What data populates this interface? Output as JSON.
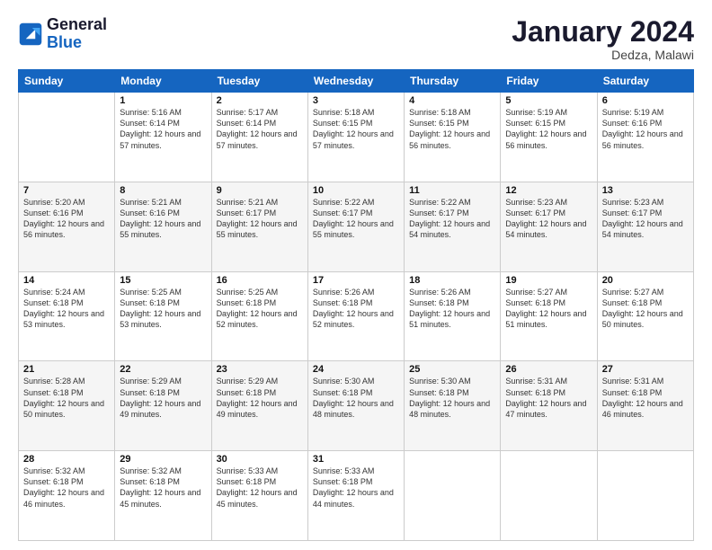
{
  "logo": {
    "line1": "General",
    "line2": "Blue"
  },
  "header": {
    "title": "January 2024",
    "subtitle": "Dedza, Malawi"
  },
  "weekdays": [
    "Sunday",
    "Monday",
    "Tuesday",
    "Wednesday",
    "Thursday",
    "Friday",
    "Saturday"
  ],
  "weeks": [
    [
      {
        "day": "",
        "sunrise": "",
        "sunset": "",
        "daylight": ""
      },
      {
        "day": "1",
        "sunrise": "Sunrise: 5:16 AM",
        "sunset": "Sunset: 6:14 PM",
        "daylight": "Daylight: 12 hours and 57 minutes."
      },
      {
        "day": "2",
        "sunrise": "Sunrise: 5:17 AM",
        "sunset": "Sunset: 6:14 PM",
        "daylight": "Daylight: 12 hours and 57 minutes."
      },
      {
        "day": "3",
        "sunrise": "Sunrise: 5:18 AM",
        "sunset": "Sunset: 6:15 PM",
        "daylight": "Daylight: 12 hours and 57 minutes."
      },
      {
        "day": "4",
        "sunrise": "Sunrise: 5:18 AM",
        "sunset": "Sunset: 6:15 PM",
        "daylight": "Daylight: 12 hours and 56 minutes."
      },
      {
        "day": "5",
        "sunrise": "Sunrise: 5:19 AM",
        "sunset": "Sunset: 6:15 PM",
        "daylight": "Daylight: 12 hours and 56 minutes."
      },
      {
        "day": "6",
        "sunrise": "Sunrise: 5:19 AM",
        "sunset": "Sunset: 6:16 PM",
        "daylight": "Daylight: 12 hours and 56 minutes."
      }
    ],
    [
      {
        "day": "7",
        "sunrise": "Sunrise: 5:20 AM",
        "sunset": "Sunset: 6:16 PM",
        "daylight": "Daylight: 12 hours and 56 minutes."
      },
      {
        "day": "8",
        "sunrise": "Sunrise: 5:21 AM",
        "sunset": "Sunset: 6:16 PM",
        "daylight": "Daylight: 12 hours and 55 minutes."
      },
      {
        "day": "9",
        "sunrise": "Sunrise: 5:21 AM",
        "sunset": "Sunset: 6:17 PM",
        "daylight": "Daylight: 12 hours and 55 minutes."
      },
      {
        "day": "10",
        "sunrise": "Sunrise: 5:22 AM",
        "sunset": "Sunset: 6:17 PM",
        "daylight": "Daylight: 12 hours and 55 minutes."
      },
      {
        "day": "11",
        "sunrise": "Sunrise: 5:22 AM",
        "sunset": "Sunset: 6:17 PM",
        "daylight": "Daylight: 12 hours and 54 minutes."
      },
      {
        "day": "12",
        "sunrise": "Sunrise: 5:23 AM",
        "sunset": "Sunset: 6:17 PM",
        "daylight": "Daylight: 12 hours and 54 minutes."
      },
      {
        "day": "13",
        "sunrise": "Sunrise: 5:23 AM",
        "sunset": "Sunset: 6:17 PM",
        "daylight": "Daylight: 12 hours and 54 minutes."
      }
    ],
    [
      {
        "day": "14",
        "sunrise": "Sunrise: 5:24 AM",
        "sunset": "Sunset: 6:18 PM",
        "daylight": "Daylight: 12 hours and 53 minutes."
      },
      {
        "day": "15",
        "sunrise": "Sunrise: 5:25 AM",
        "sunset": "Sunset: 6:18 PM",
        "daylight": "Daylight: 12 hours and 53 minutes."
      },
      {
        "day": "16",
        "sunrise": "Sunrise: 5:25 AM",
        "sunset": "Sunset: 6:18 PM",
        "daylight": "Daylight: 12 hours and 52 minutes."
      },
      {
        "day": "17",
        "sunrise": "Sunrise: 5:26 AM",
        "sunset": "Sunset: 6:18 PM",
        "daylight": "Daylight: 12 hours and 52 minutes."
      },
      {
        "day": "18",
        "sunrise": "Sunrise: 5:26 AM",
        "sunset": "Sunset: 6:18 PM",
        "daylight": "Daylight: 12 hours and 51 minutes."
      },
      {
        "day": "19",
        "sunrise": "Sunrise: 5:27 AM",
        "sunset": "Sunset: 6:18 PM",
        "daylight": "Daylight: 12 hours and 51 minutes."
      },
      {
        "day": "20",
        "sunrise": "Sunrise: 5:27 AM",
        "sunset": "Sunset: 6:18 PM",
        "daylight": "Daylight: 12 hours and 50 minutes."
      }
    ],
    [
      {
        "day": "21",
        "sunrise": "Sunrise: 5:28 AM",
        "sunset": "Sunset: 6:18 PM",
        "daylight": "Daylight: 12 hours and 50 minutes."
      },
      {
        "day": "22",
        "sunrise": "Sunrise: 5:29 AM",
        "sunset": "Sunset: 6:18 PM",
        "daylight": "Daylight: 12 hours and 49 minutes."
      },
      {
        "day": "23",
        "sunrise": "Sunrise: 5:29 AM",
        "sunset": "Sunset: 6:18 PM",
        "daylight": "Daylight: 12 hours and 49 minutes."
      },
      {
        "day": "24",
        "sunrise": "Sunrise: 5:30 AM",
        "sunset": "Sunset: 6:18 PM",
        "daylight": "Daylight: 12 hours and 48 minutes."
      },
      {
        "day": "25",
        "sunrise": "Sunrise: 5:30 AM",
        "sunset": "Sunset: 6:18 PM",
        "daylight": "Daylight: 12 hours and 48 minutes."
      },
      {
        "day": "26",
        "sunrise": "Sunrise: 5:31 AM",
        "sunset": "Sunset: 6:18 PM",
        "daylight": "Daylight: 12 hours and 47 minutes."
      },
      {
        "day": "27",
        "sunrise": "Sunrise: 5:31 AM",
        "sunset": "Sunset: 6:18 PM",
        "daylight": "Daylight: 12 hours and 46 minutes."
      }
    ],
    [
      {
        "day": "28",
        "sunrise": "Sunrise: 5:32 AM",
        "sunset": "Sunset: 6:18 PM",
        "daylight": "Daylight: 12 hours and 46 minutes."
      },
      {
        "day": "29",
        "sunrise": "Sunrise: 5:32 AM",
        "sunset": "Sunset: 6:18 PM",
        "daylight": "Daylight: 12 hours and 45 minutes."
      },
      {
        "day": "30",
        "sunrise": "Sunrise: 5:33 AM",
        "sunset": "Sunset: 6:18 PM",
        "daylight": "Daylight: 12 hours and 45 minutes."
      },
      {
        "day": "31",
        "sunrise": "Sunrise: 5:33 AM",
        "sunset": "Sunset: 6:18 PM",
        "daylight": "Daylight: 12 hours and 44 minutes."
      },
      {
        "day": "",
        "sunrise": "",
        "sunset": "",
        "daylight": ""
      },
      {
        "day": "",
        "sunrise": "",
        "sunset": "",
        "daylight": ""
      },
      {
        "day": "",
        "sunrise": "",
        "sunset": "",
        "daylight": ""
      }
    ]
  ]
}
